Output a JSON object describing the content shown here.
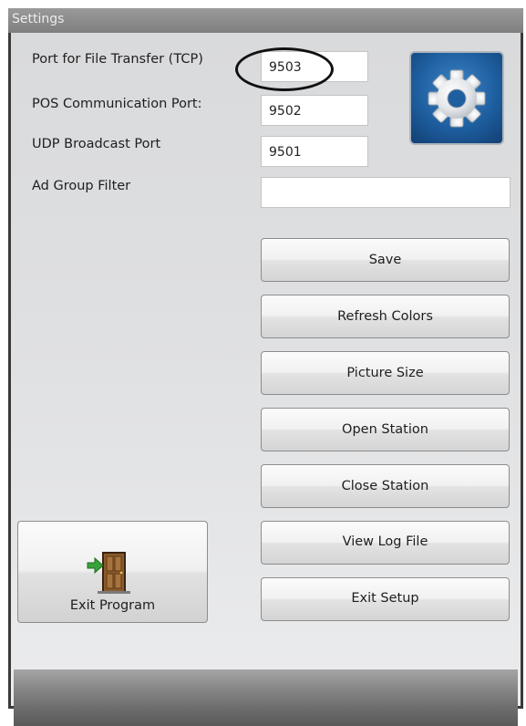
{
  "window": {
    "title": "Settings"
  },
  "fields": [
    {
      "label": "Port for File Transfer (TCP)",
      "value": "9503"
    },
    {
      "label": "POS Communication Port:",
      "value": "9502"
    },
    {
      "label": "UDP Broadcast Port",
      "value": "9501"
    },
    {
      "label": "Ad Group Filter",
      "value": ""
    }
  ],
  "buttons": {
    "save": "Save",
    "refresh_colors": "Refresh Colors",
    "picture_size": "Picture Size",
    "open_station": "Open Station",
    "close_station": "Close Station",
    "view_log_file": "View Log File",
    "exit_setup": "Exit Setup",
    "exit_program": "Exit Program"
  },
  "icons": {
    "settings": "gear-icon",
    "exit": "door-exit-icon"
  },
  "colors": {
    "gear_tile": "#1e5fa0",
    "exit_arrow": "#3aa23a"
  }
}
